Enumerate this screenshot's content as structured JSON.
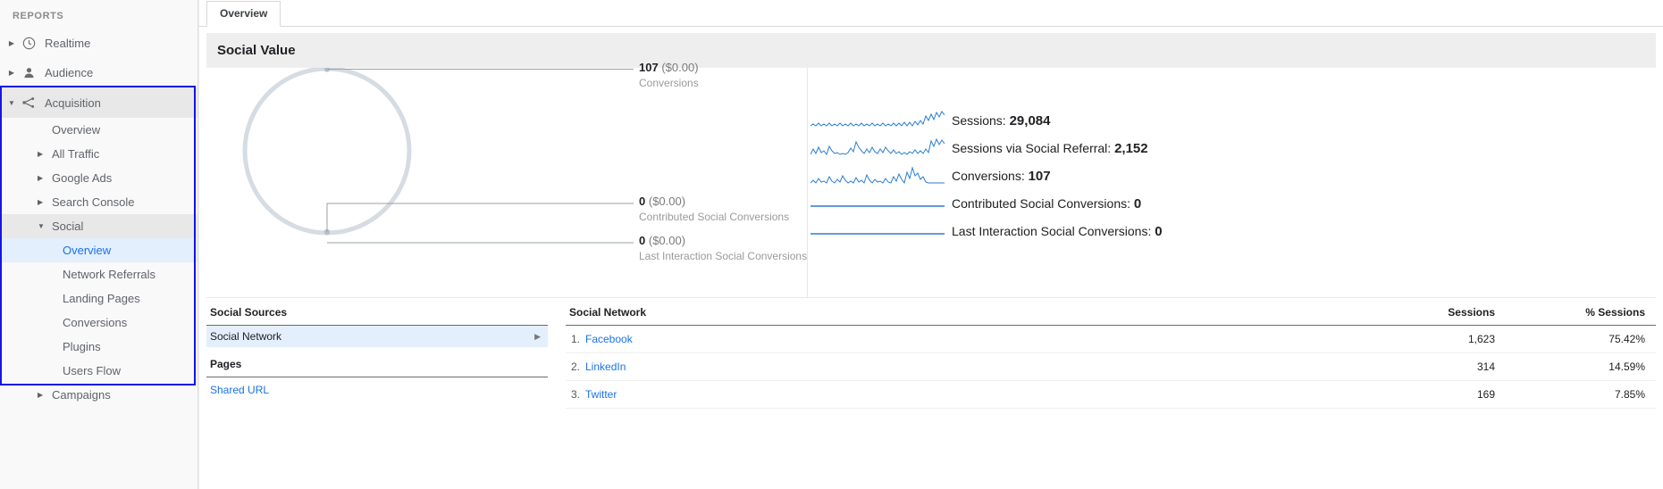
{
  "sidebar": {
    "section_label": "REPORTS",
    "items": [
      {
        "label": "Realtime",
        "icon": "clock-icon"
      },
      {
        "label": "Audience",
        "icon": "person-icon"
      },
      {
        "label": "Acquisition",
        "icon": "acquisition-icon"
      }
    ],
    "acquisition_children": [
      {
        "label": "Overview",
        "has_arrow": false
      },
      {
        "label": "All Traffic",
        "has_arrow": true
      },
      {
        "label": "Google Ads",
        "has_arrow": true
      },
      {
        "label": "Search Console",
        "has_arrow": true
      },
      {
        "label": "Social",
        "has_arrow": true,
        "expanded": true
      }
    ],
    "social_children": [
      {
        "label": "Overview",
        "active": true
      },
      {
        "label": "Network Referrals",
        "active": false
      },
      {
        "label": "Landing Pages",
        "active": false
      },
      {
        "label": "Conversions",
        "active": false
      },
      {
        "label": "Plugins",
        "active": false
      },
      {
        "label": "Users Flow",
        "active": false
      }
    ],
    "campaigns": {
      "label": "Campaigns",
      "has_arrow": true
    }
  },
  "tab": {
    "label": "Overview"
  },
  "panel": {
    "title": "Social Value"
  },
  "funnel": {
    "nodes": [
      {
        "value": "107",
        "money": "($0.00)",
        "sub": "Conversions"
      },
      {
        "value": "0",
        "money": "($0.00)",
        "sub": "Contributed Social Conversions"
      },
      {
        "value": "0",
        "money": "($0.00)",
        "sub": "Last Interaction Social Conversions"
      }
    ]
  },
  "metrics": [
    {
      "label": "Sessions:",
      "value": "29,084",
      "spark": "sessions-sparkline"
    },
    {
      "label": "Sessions via Social Referral:",
      "value": "2,152",
      "spark": "social-referral-sparkline"
    },
    {
      "label": "Conversions:",
      "value": "107",
      "spark": "conversions-sparkline"
    },
    {
      "label": "Contributed Social Conversions:",
      "value": "0",
      "spark": "contributed-sparkline"
    },
    {
      "label": "Last Interaction Social Conversions:",
      "value": "0",
      "spark": "last-interaction-sparkline"
    }
  ],
  "social_sources": {
    "header": "Social Sources",
    "row": "Social Network",
    "pages_header": "Pages",
    "page_link": "Shared URL"
  },
  "network_table": {
    "columns": {
      "name": "Social Network",
      "sessions": "Sessions",
      "pct": "% Sessions"
    },
    "rows": [
      {
        "rank": "1.",
        "name": "Facebook",
        "sessions": "1,623",
        "pct": "75.42%",
        "pct_value": 75.42
      },
      {
        "rank": "2.",
        "name": "LinkedIn",
        "sessions": "314",
        "pct": "14.59%",
        "pct_value": 14.59
      },
      {
        "rank": "3.",
        "name": "Twitter",
        "sessions": "169",
        "pct": "7.85%",
        "pct_value": 7.85
      }
    ]
  },
  "colors": {
    "accent": "#1a73e8",
    "bar": "#2b7dd1",
    "focus": "#1414e6",
    "spark": "#2b7dd1"
  }
}
